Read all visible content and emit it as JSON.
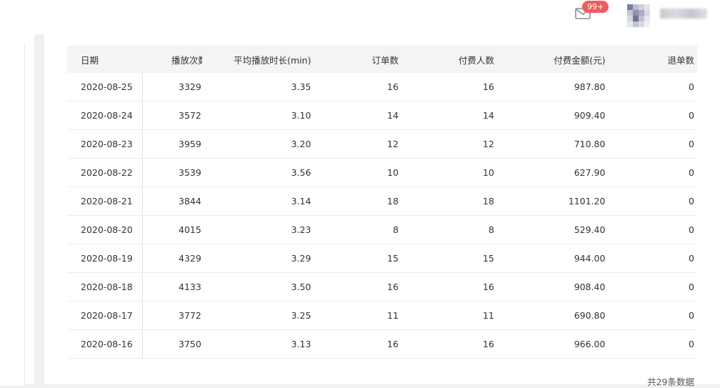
{
  "header": {
    "notification_badge": "99+",
    "mail_icon": "mail-icon",
    "avatar": "avatar-icon"
  },
  "table": {
    "columns": {
      "date": "日期",
      "plays": "播放次数",
      "avg_duration": "平均播放时长(min)",
      "orders": "订单数",
      "payers": "付费人数",
      "amount": "付费金额(元)",
      "refunds": "退单数"
    },
    "rows": [
      {
        "date": "2020-08-25",
        "plays": "3329",
        "avg": "3.35",
        "orders": "16",
        "payers": "16",
        "amount": "987.80",
        "refunds": "0"
      },
      {
        "date": "2020-08-24",
        "plays": "3572",
        "avg": "3.10",
        "orders": "14",
        "payers": "14",
        "amount": "909.40",
        "refunds": "0"
      },
      {
        "date": "2020-08-23",
        "plays": "3959",
        "avg": "3.20",
        "orders": "12",
        "payers": "12",
        "amount": "710.80",
        "refunds": "0"
      },
      {
        "date": "2020-08-22",
        "plays": "3539",
        "avg": "3.56",
        "orders": "10",
        "payers": "10",
        "amount": "627.90",
        "refunds": "0"
      },
      {
        "date": "2020-08-21",
        "plays": "3844",
        "avg": "3.14",
        "orders": "18",
        "payers": "18",
        "amount": "1101.20",
        "refunds": "0"
      },
      {
        "date": "2020-08-20",
        "plays": "4015",
        "avg": "3.23",
        "orders": "8",
        "payers": "8",
        "amount": "529.40",
        "refunds": "0"
      },
      {
        "date": "2020-08-19",
        "plays": "4329",
        "avg": "3.29",
        "orders": "15",
        "payers": "15",
        "amount": "944.00",
        "refunds": "0"
      },
      {
        "date": "2020-08-18",
        "plays": "4133",
        "avg": "3.50",
        "orders": "16",
        "payers": "16",
        "amount": "908.40",
        "refunds": "0"
      },
      {
        "date": "2020-08-17",
        "plays": "3772",
        "avg": "3.25",
        "orders": "11",
        "payers": "11",
        "amount": "690.80",
        "refunds": "0"
      },
      {
        "date": "2020-08-16",
        "plays": "3750",
        "avg": "3.13",
        "orders": "16",
        "payers": "16",
        "amount": "966.00",
        "refunds": "0"
      }
    ]
  },
  "footer": {
    "total": "共29条数据"
  }
}
